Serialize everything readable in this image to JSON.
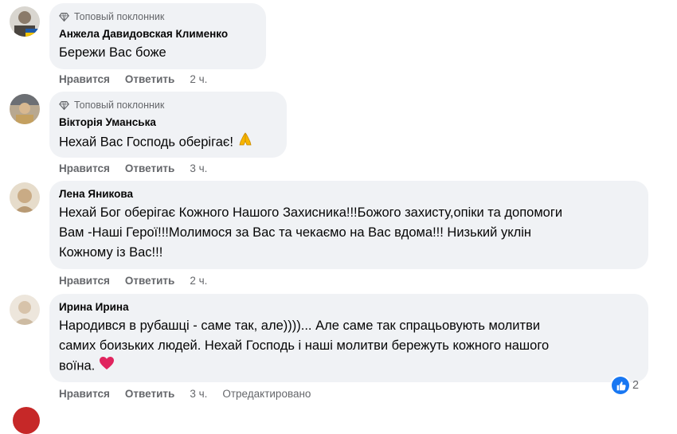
{
  "comments": [
    {
      "badge": "Топовый поклонник",
      "author": "Анжела Давидовская Клименко",
      "text": "Бережи Вас боже",
      "like": "Нравится",
      "reply": "Ответить",
      "time": "2 ч."
    },
    {
      "badge": "Топовый поклонник",
      "author": "Вікторія Уманська",
      "text": "Нехай Вас Господь оберігає!",
      "emoji": "folded-hands",
      "like": "Нравится",
      "reply": "Ответить",
      "time": "3 ч."
    },
    {
      "author": "Лена Яникова",
      "lines": [
        "Нехай Бог оберігає Кожного Нашого Захисника!!!Божого захисту,опіки та допомоги",
        "Вам -Наші Герої!!!Молимося за Вас та чекаємо на Вас вдома!!! Низький уклін",
        "Кожному із Вас!!!"
      ],
      "like": "Нравится",
      "reply": "Ответить",
      "time": "2 ч."
    },
    {
      "author": "Ирина Ирина",
      "lines": [
        "Народився в рубашці - саме так, але))))... Але саме так спрацьовують молитви",
        "самих боизьких людей. Нехай Господь і наші молитви бережуть кожного нашого",
        "воїна."
      ],
      "emoji": "red-heart",
      "like": "Нравится",
      "reply": "Ответить",
      "time": "3 ч.",
      "edited": "Отредактировано",
      "reaction_count": "2"
    }
  ],
  "colors": {
    "bubble": "#f0f2f5",
    "meta": "#65676b",
    "like_blue": "#1877f2"
  }
}
